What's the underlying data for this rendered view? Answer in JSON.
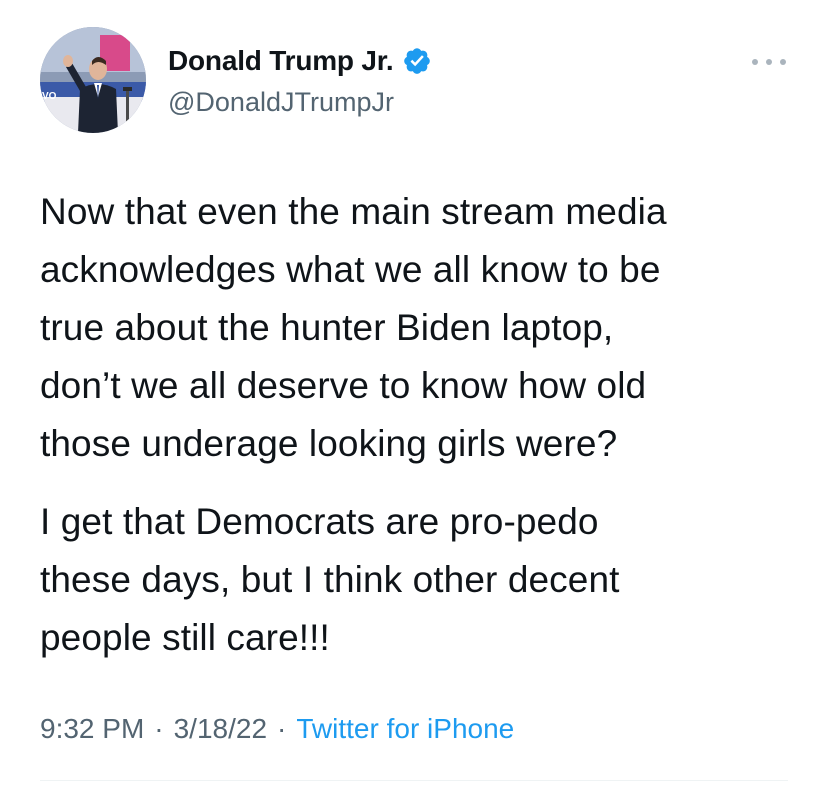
{
  "tweet": {
    "author": {
      "display_name": "Donald Trump Jr.",
      "handle": "@DonaldJTrumpJr",
      "verified": true,
      "verified_icon": "verified-badge-icon",
      "avatar_icon": "profile-photo"
    },
    "more_icon": "more-options-icon",
    "paragraphs": [
      "Now that even the main stream media\nacknowledges what we all know to be\ntrue about the hunter Biden laptop,\ndon’t we all deserve to know how old\nthose underage looking girls were?",
      "I get that Democrats are pro-pedo\nthese days, but I think other decent\npeople still care!!!"
    ],
    "time": "9:32 PM",
    "date": "3/18/22",
    "separator": "·",
    "source": "Twitter for iPhone"
  },
  "colors": {
    "text": "#0f1419",
    "secondary": "#536471",
    "link": "#1d9bf0",
    "verified": "#1d9bf0",
    "divider": "#eff3f4"
  }
}
